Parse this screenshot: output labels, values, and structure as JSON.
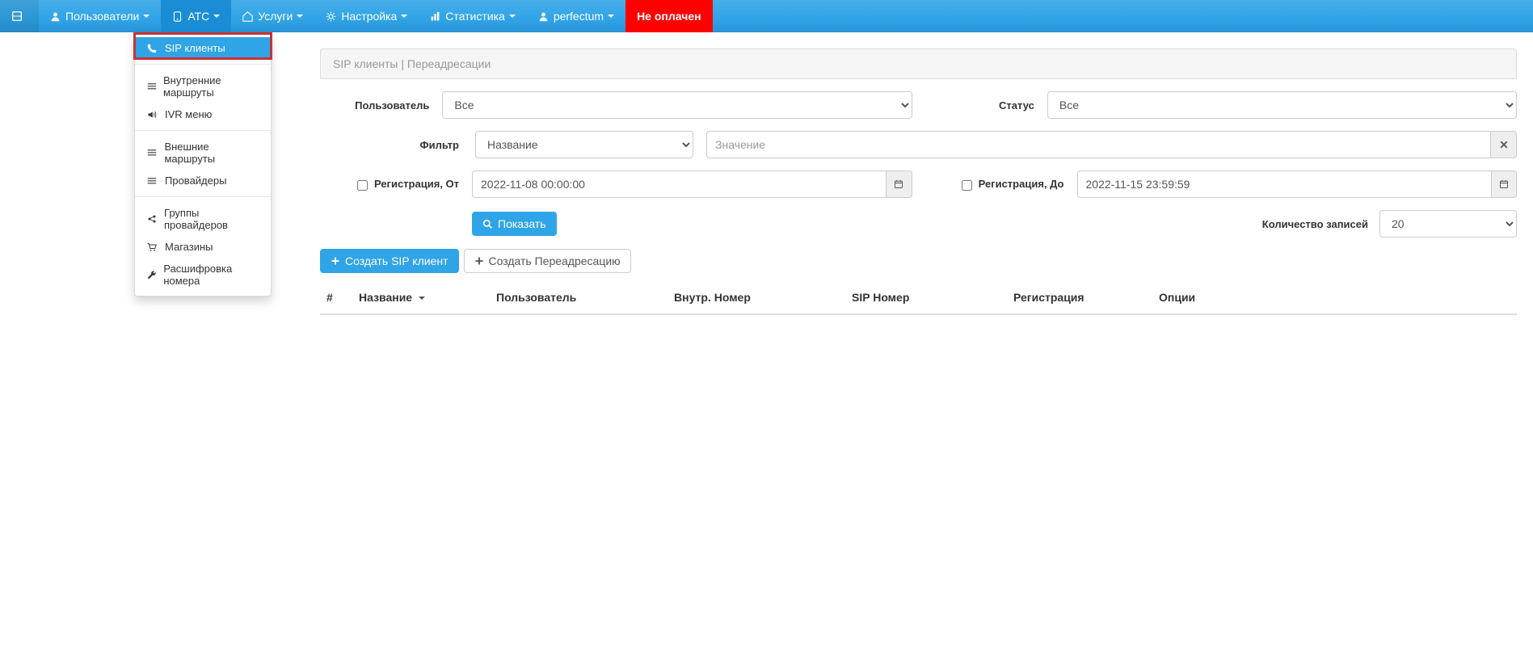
{
  "nav": {
    "users": "Пользователи",
    "atc": "АТС",
    "services": "Услуги",
    "settings": "Настройка",
    "statistics": "Статистика",
    "perfectum": "perfectum",
    "unpaid": "Не оплачен"
  },
  "dropdown": {
    "sip_clients": "SIP клиенты",
    "internal_routes": "Внутренние маршруты",
    "ivr_menu": "IVR меню",
    "external_routes": "Внешние маршруты",
    "providers": "Провайдеры",
    "provider_groups": "Группы провайдеров",
    "shops": "Магазины",
    "number_decode": "Расшифровка номера"
  },
  "breadcrumb": {
    "sip_clients": "SIP клиенты",
    "redirections": "Переадресации"
  },
  "filters": {
    "user_label": "Пользователь",
    "user_value": "Все",
    "status_label": "Статус",
    "status_value": "Все",
    "filter_label": "Фильтр",
    "filter_by_value": "Название",
    "filter_value_placeholder": "Значение",
    "reg_from_label": "Регистрация, От",
    "reg_from_value": "2022-11-08 00:00:00",
    "reg_to_label": "Регистрация, До",
    "reg_to_value": "2022-11-15 23:59:59",
    "show_btn": "Показать",
    "records_label": "Количество записей",
    "records_value": "20"
  },
  "actions": {
    "create_sip": "Создать SIP клиент",
    "create_redirect": "Создать Переадресацию"
  },
  "columns": {
    "num": "#",
    "name": "Название",
    "user": "Пользователь",
    "int_number": "Внутр. Номер",
    "sip_number": "SIP Номер",
    "registration": "Регистрация",
    "options": "Опции"
  }
}
